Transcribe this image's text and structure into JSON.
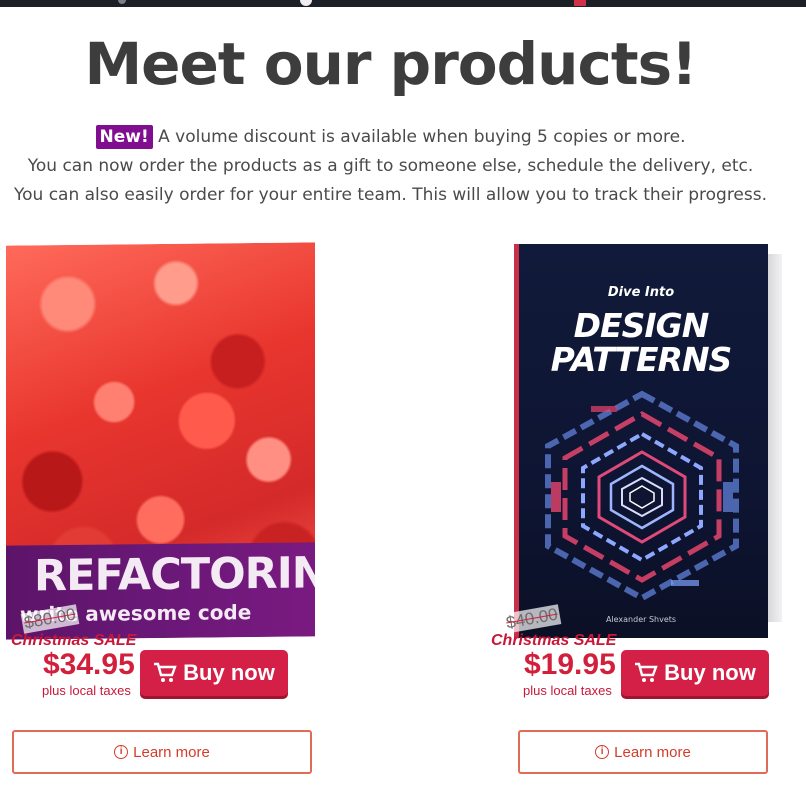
{
  "header": {
    "title": "Meet our products!",
    "new_badge": "New!",
    "intro_line1": " A volume discount is available when buying 5 copies or more.",
    "intro_line2": "You can now order the products as a gift to someone else, schedule the delivery, etc.",
    "intro_line3": "You can also easily order for your entire team. This will allow you to track their progress."
  },
  "colors": {
    "accent": "#d41f47",
    "badge": "#7f0f8f",
    "learn_more_border": "#e26b56",
    "heading": "#3d3d3d"
  },
  "products": [
    {
      "cover_title": "REFACTORING",
      "cover_subtitle": "write awesome code",
      "old_price": "$80.00",
      "sale_label": "Christmas SALE",
      "price": "$34.95",
      "taxes_note": "plus local taxes",
      "buy_label": "Buy now",
      "learn_label": "Learn more"
    },
    {
      "cover_pretitle": "Dive Into",
      "cover_title_line1": "DESIGN",
      "cover_title_line2": "PATTERNS",
      "cover_author": "Alexander Shvets",
      "old_price": "$40.00",
      "sale_label": "Christmas SALE",
      "price": "$19.95",
      "taxes_note": "plus local taxes",
      "buy_label": "Buy now",
      "learn_label": "Learn more"
    }
  ],
  "icons": {
    "cart": "shopping-cart-icon",
    "info": "info-circle-icon"
  }
}
